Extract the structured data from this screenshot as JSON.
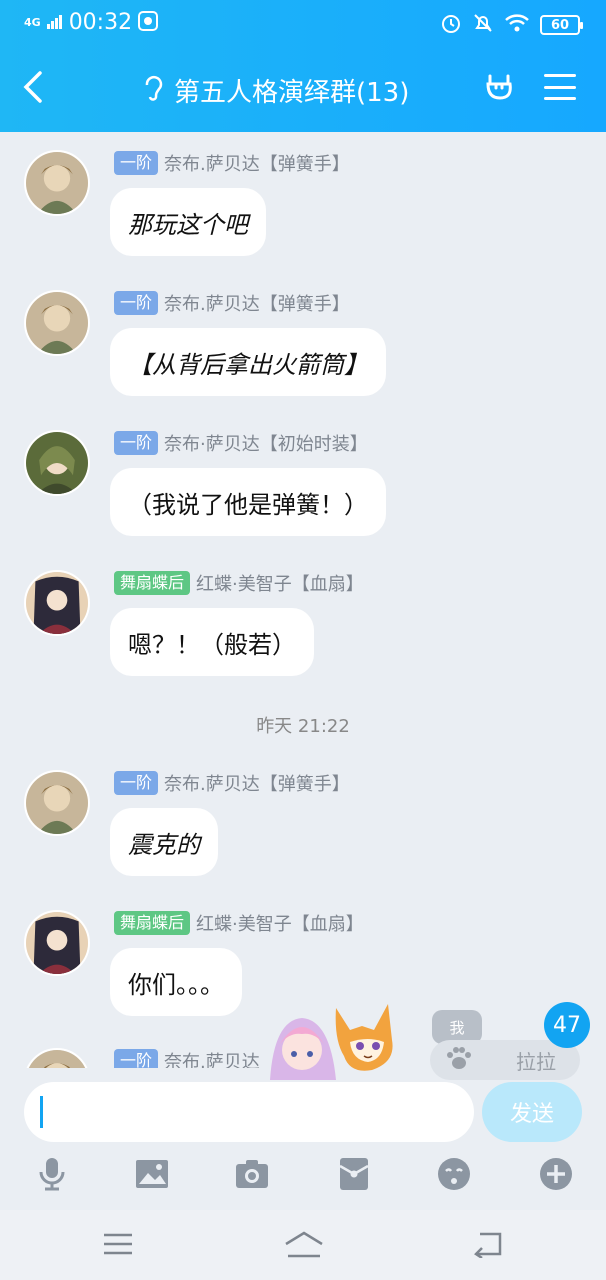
{
  "status_bar": {
    "network": "4G",
    "time": "00:32",
    "battery": "60"
  },
  "header": {
    "title": "第五人格演绎群(13)"
  },
  "messages": [
    {
      "badge": "一阶",
      "badge_color": "#7ba8e8",
      "sender": "奈布.萨贝达【弹簧手】",
      "text": "那玩这个吧"
    },
    {
      "badge": "一阶",
      "badge_color": "#7ba8e8",
      "sender": "奈布.萨贝达【弹簧手】",
      "text": "【从背后拿出火箭筒】"
    },
    {
      "badge": "一阶",
      "badge_color": "#7ba8e8",
      "sender": "奈布·萨贝达【初始时装】",
      "text": "（我说了他是弹簧！）"
    },
    {
      "badge": "舞扇蝶后",
      "badge_color": "#5ec784",
      "sender": "红蝶·美智子【血扇】",
      "text": "嗯？！（般若）"
    },
    {
      "badge": "一阶",
      "badge_color": "#7ba8e8",
      "sender": "奈布.萨贝达【弹簧手】",
      "text": "震克的"
    },
    {
      "badge": "舞扇蝶后",
      "badge_color": "#5ec784",
      "sender": "红蝶·美智子【血扇】",
      "text": "你们。。。"
    },
    {
      "badge": "一阶",
      "badge_color": "#7ba8e8",
      "sender": "奈布.萨贝达",
      "text": ""
    }
  ],
  "timestamp": "昨天 21:22",
  "pet_widget": {
    "me_label": "我",
    "name": "拉拉",
    "unread_count": "47"
  },
  "input": {
    "placeholder": "",
    "send_label": "发送"
  },
  "colors": {
    "accent": "#12a4f2",
    "header_bg": "#1fb7f5"
  }
}
